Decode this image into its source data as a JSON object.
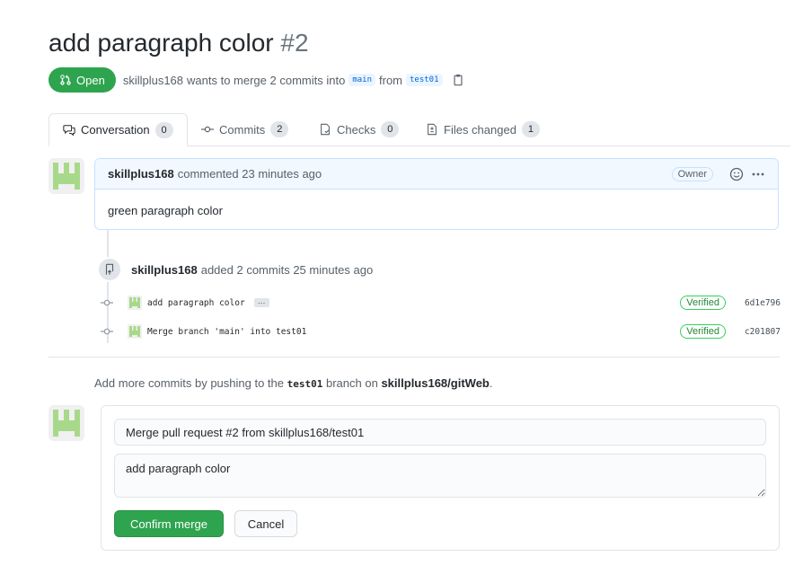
{
  "pr": {
    "title": "add paragraph color",
    "number": "#2",
    "state": "Open",
    "author": "skillplus168",
    "merge_text": "wants to merge 2 commits into",
    "base_branch": "main",
    "from_text": "from",
    "head_branch": "test01"
  },
  "tabs": [
    {
      "label": "Conversation",
      "count": "0",
      "icon": "comment-discussion-icon"
    },
    {
      "label": "Commits",
      "count": "2",
      "icon": "git-commit-icon"
    },
    {
      "label": "Checks",
      "count": "0",
      "icon": "checklist-icon"
    },
    {
      "label": "Files changed",
      "count": "1",
      "icon": "file-diff-icon"
    }
  ],
  "comment": {
    "author": "skillplus168",
    "action": "commented 23 minutes ago",
    "role_badge": "Owner",
    "body": "green paragraph color"
  },
  "commit_event": {
    "author": "skillplus168",
    "action": "added 2 commits 25 minutes ago"
  },
  "commits": [
    {
      "message": "add paragraph color",
      "has_ellipsis": true,
      "ellipsis": "…",
      "verified": "Verified",
      "sha": "6d1e796"
    },
    {
      "message": "Merge branch 'main' into test01",
      "has_ellipsis": false,
      "verified": "Verified",
      "sha": "c201807"
    }
  ],
  "push_hint": {
    "prefix": "Add more commits by pushing to the",
    "branch": "test01",
    "middle": "branch on",
    "repo": "skillplus168/gitWeb",
    "suffix": "."
  },
  "merge_form": {
    "title_value": "Merge pull request #2 from skillplus168/test01",
    "body_value": "add paragraph color",
    "confirm_label": "Confirm merge",
    "cancel_label": "Cancel"
  },
  "colors": {
    "open_green": "#2ea44f",
    "link_blue": "#0366d6",
    "verified_green": "#22863a",
    "avatar_green": "#a8d98a"
  }
}
